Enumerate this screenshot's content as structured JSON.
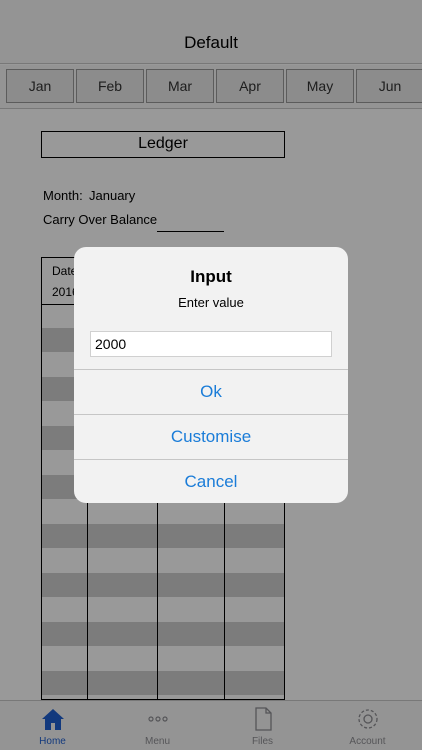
{
  "nav": {
    "title": "Default"
  },
  "months": [
    "Jan",
    "Feb",
    "Mar",
    "Apr",
    "May",
    "Jun"
  ],
  "ledger": {
    "title": "Ledger",
    "month_label": "Month:",
    "month_value": "January",
    "carry_label": "Carry Over Balance",
    "table_head_1": "Date",
    "table_head_2": "2016"
  },
  "dialog": {
    "title": "Input",
    "message": "Enter value",
    "input_value": "2000",
    "buttons": [
      "Ok",
      "Customise",
      "Cancel"
    ]
  },
  "tabbar": {
    "items": [
      {
        "label": "Home",
        "icon": "home-icon"
      },
      {
        "label": "Menu",
        "icon": "more-icon"
      },
      {
        "label": "Files",
        "icon": "file-icon"
      },
      {
        "label": "Account",
        "icon": "gear-icon"
      }
    ],
    "active_color": "#1f5fd0"
  },
  "colors": {
    "accent": "#1a7cd8",
    "row_shade": "#cfcfcf"
  }
}
